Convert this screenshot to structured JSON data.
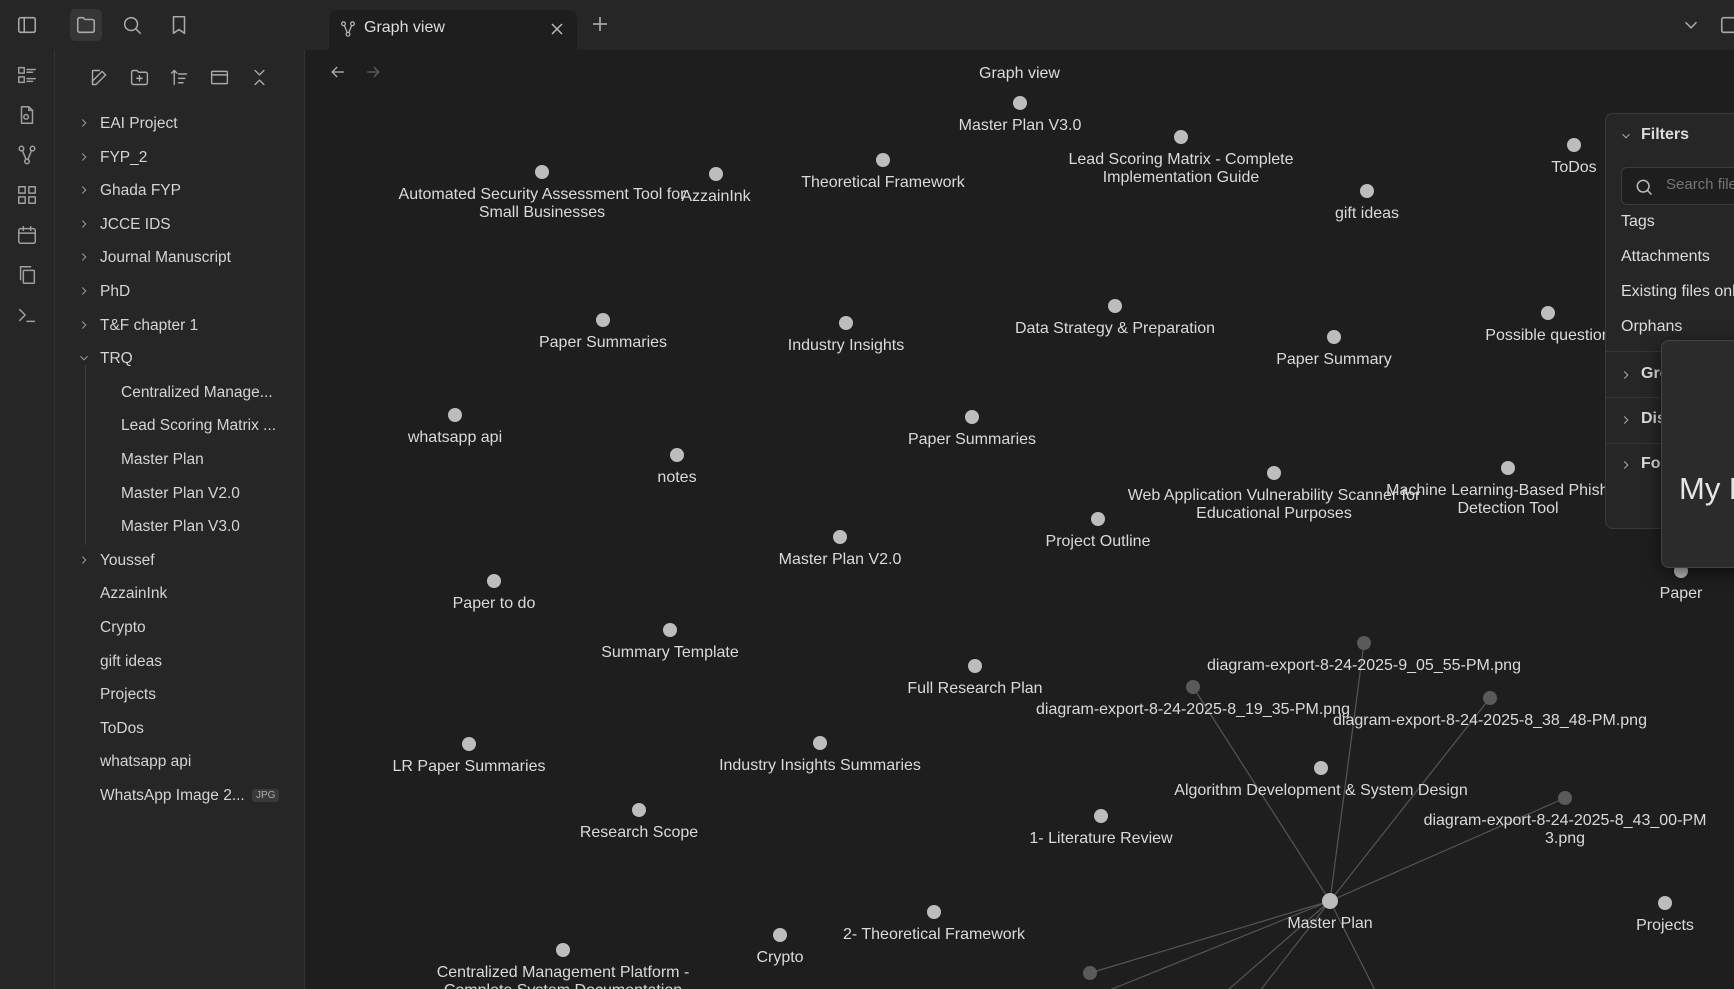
{
  "tab": {
    "label": "Graph view"
  },
  "view": {
    "title": "Graph view"
  },
  "sidebar": {
    "tree": [
      {
        "label": "EAI Project",
        "type": "folder",
        "expanded": false,
        "level": 0
      },
      {
        "label": "FYP_2",
        "type": "folder",
        "expanded": false,
        "level": 0
      },
      {
        "label": "Ghada FYP",
        "type": "folder",
        "expanded": false,
        "level": 0
      },
      {
        "label": "JCCE IDS",
        "type": "folder",
        "expanded": false,
        "level": 0
      },
      {
        "label": "Journal Manuscript",
        "type": "folder",
        "expanded": false,
        "level": 0
      },
      {
        "label": "PhD",
        "type": "folder",
        "expanded": false,
        "level": 0
      },
      {
        "label": "T&F chapter 1",
        "type": "folder",
        "expanded": false,
        "level": 0
      },
      {
        "label": "TRQ",
        "type": "folder",
        "expanded": true,
        "level": 0
      },
      {
        "label": "Centralized Manage...",
        "type": "file",
        "level": 1
      },
      {
        "label": "Lead Scoring Matrix ...",
        "type": "file",
        "level": 1
      },
      {
        "label": "Master Plan",
        "type": "file",
        "level": 1
      },
      {
        "label": "Master Plan V2.0",
        "type": "file",
        "level": 1
      },
      {
        "label": "Master Plan V3.0",
        "type": "file",
        "level": 1
      },
      {
        "label": "Youssef",
        "type": "folder",
        "expanded": false,
        "level": 0
      },
      {
        "label": "AzzainInk",
        "type": "file",
        "level": 0
      },
      {
        "label": "Crypto",
        "type": "file",
        "level": 0
      },
      {
        "label": "gift ideas",
        "type": "file",
        "level": 0
      },
      {
        "label": "Projects",
        "type": "file",
        "level": 0
      },
      {
        "label": "ToDos",
        "type": "file",
        "level": 0
      },
      {
        "label": "whatsapp api",
        "type": "file",
        "level": 0
      },
      {
        "label": "WhatsApp Image 2...",
        "type": "file",
        "level": 0,
        "badge": "JPG"
      }
    ]
  },
  "graph": {
    "nodes": [
      {
        "id": "master-plan-v3",
        "label": [
          "Master Plan V3.0"
        ]
      },
      {
        "id": "lead-scoring",
        "label": [
          "Lead Scoring Matrix - Complete",
          "Implementation Guide"
        ]
      },
      {
        "id": "todos",
        "label": [
          "ToDos"
        ]
      },
      {
        "id": "automated-security",
        "label": [
          "Automated Security Assessment Tool for",
          "Small Businesses"
        ]
      },
      {
        "id": "azzainink",
        "label": [
          "AzzainInk"
        ]
      },
      {
        "id": "theoretical-framework",
        "label": [
          "Theoretical Framework"
        ]
      },
      {
        "id": "gift-ideas",
        "label": [
          "gift ideas"
        ]
      },
      {
        "id": "paper-summaries-1",
        "label": [
          "Paper Summaries"
        ]
      },
      {
        "id": "industry-insights",
        "label": [
          "Industry Insights"
        ]
      },
      {
        "id": "data-strategy",
        "label": [
          "Data Strategy & Preparation"
        ]
      },
      {
        "id": "paper-summary",
        "label": [
          "Paper Summary"
        ]
      },
      {
        "id": "possible-questions",
        "label": [
          "Possible question"
        ]
      },
      {
        "id": "whatsapp-api",
        "label": [
          "whatsapp api"
        ]
      },
      {
        "id": "notes",
        "label": [
          "notes"
        ]
      },
      {
        "id": "paper-summaries-2",
        "label": [
          "Paper Summaries"
        ]
      },
      {
        "id": "web-app-scanner",
        "label": [
          "Web Application Vulnerability Scanner for",
          "Educational Purposes"
        ]
      },
      {
        "id": "ml-phishing",
        "label": [
          "Machine Learning-Based Phishing",
          "Detection Tool"
        ]
      },
      {
        "id": "project-outline",
        "label": [
          "Project Outline"
        ]
      },
      {
        "id": "master-plan-v2",
        "label": [
          "Master Plan V2.0"
        ]
      },
      {
        "id": "paper",
        "label": [
          "Paper"
        ]
      },
      {
        "id": "paper-to-do",
        "label": [
          "Paper to do"
        ]
      },
      {
        "id": "summary-template",
        "label": [
          "Summary Template"
        ]
      },
      {
        "id": "diagram-9-05",
        "label": [
          "diagram-export-8-24-2025-9_05_55-PM.png"
        ]
      },
      {
        "id": "full-research-plan",
        "label": [
          "Full Research Plan"
        ]
      },
      {
        "id": "diagram-8-19",
        "label": [
          "diagram-export-8-24-2025-8_19_35-PM.png"
        ]
      },
      {
        "id": "diagram-8-38",
        "label": [
          "diagram-export-8-24-2025-8_38_48-PM.png"
        ]
      },
      {
        "id": "lr-paper-summaries",
        "label": [
          "LR Paper Summaries"
        ]
      },
      {
        "id": "industry-insights-summaries",
        "label": [
          "Industry Insights Summaries"
        ]
      },
      {
        "id": "algorithm-dev",
        "label": [
          "Algorithm Development & System Design"
        ]
      },
      {
        "id": "diagram-8-43",
        "label": [
          "diagram-export-8-24-2025-8_43_00-PM",
          "3.png"
        ]
      },
      {
        "id": "research-scope",
        "label": [
          "Research Scope"
        ]
      },
      {
        "id": "literature-review",
        "label": [
          "1- Literature Review"
        ]
      },
      {
        "id": "master-plan",
        "label": [
          "Master Plan"
        ]
      },
      {
        "id": "projects",
        "label": [
          "Projects"
        ]
      },
      {
        "id": "theoretical-framework-2",
        "label": [
          "2- Theoretical Framework"
        ]
      },
      {
        "id": "crypto",
        "label": [
          "Crypto"
        ]
      },
      {
        "id": "centralized-mgmt",
        "label": [
          "Centralized Management Platform -",
          "Complete System Documentation"
        ]
      },
      {
        "id": "bottom-node",
        "label": []
      }
    ]
  },
  "filters": {
    "title": "Filters",
    "search_placeholder": "Search files...",
    "tags": "Tags",
    "attachments": "Attachments",
    "existing_only": "Existing files only",
    "orphans": "Orphans",
    "groups": "Groups",
    "display": "Display",
    "forces": "Forces"
  },
  "popup": {
    "title": "My Pl"
  },
  "colors": {
    "node": "#bdbdbd",
    "node_dim": "#5a5a5a",
    "edge": "#555555",
    "background": "#1e1e1e",
    "panel": "#262626"
  }
}
